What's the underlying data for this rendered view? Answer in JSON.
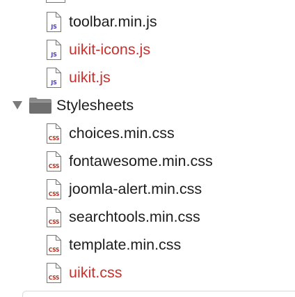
{
  "tree": {
    "js_files": [
      {
        "name": "toolbar.min.js",
        "badge": "JS",
        "modified": false
      },
      {
        "name": "uikit-icons.js",
        "badge": "JS",
        "modified": true
      },
      {
        "name": "uikit.js",
        "badge": "JS",
        "modified": true
      }
    ],
    "folder": {
      "name": "Stylesheets",
      "expanded": true
    },
    "css_files": [
      {
        "name": "choices.min.css",
        "badge": "CSS",
        "modified": false
      },
      {
        "name": "fontawesome.min.css",
        "badge": "CSS",
        "modified": false
      },
      {
        "name": "joomla-alert.min.css",
        "badge": "CSS",
        "modified": false
      },
      {
        "name": "searchtools.min.css",
        "badge": "CSS",
        "modified": false
      },
      {
        "name": "template.min.css",
        "badge": "CSS",
        "modified": false
      },
      {
        "name": "uikit.css",
        "badge": "CSS",
        "modified": true
      }
    ]
  },
  "colors": {
    "text": "#1d1d1f",
    "modified": "#c9302c",
    "js_badge": "#4b3fb5",
    "css_badge": "#b0301f",
    "folder": "#6f6f6f"
  },
  "icons": {
    "file": "document-icon",
    "folder": "folder-icon",
    "disclosure": "disclosure-triangle-down-icon"
  }
}
